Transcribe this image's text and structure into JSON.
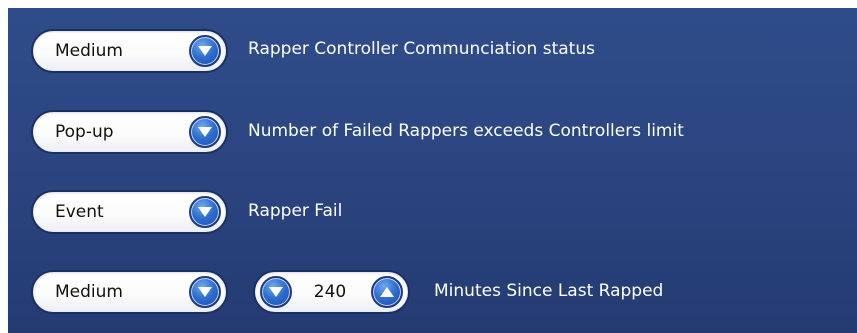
{
  "alarms": [
    {
      "severity": "Medium",
      "description": "Rapper Controller Communciation status"
    },
    {
      "severity": "Pop-up",
      "description": "Number of Failed Rappers exceeds Controllers limit"
    },
    {
      "severity": "Event",
      "description": "Rapper Fail"
    },
    {
      "severity": "Medium",
      "description": "Minutes Since Last Rapped",
      "stepper_value": "240"
    }
  ],
  "icons": {
    "dropdown": "chevron-down-icon",
    "decrement": "chevron-down-icon",
    "increment": "chevron-up-icon"
  },
  "colors": {
    "panel_background": "#2a447f",
    "button_blue": "#2f6fd0",
    "label_text": "#ffffff"
  }
}
